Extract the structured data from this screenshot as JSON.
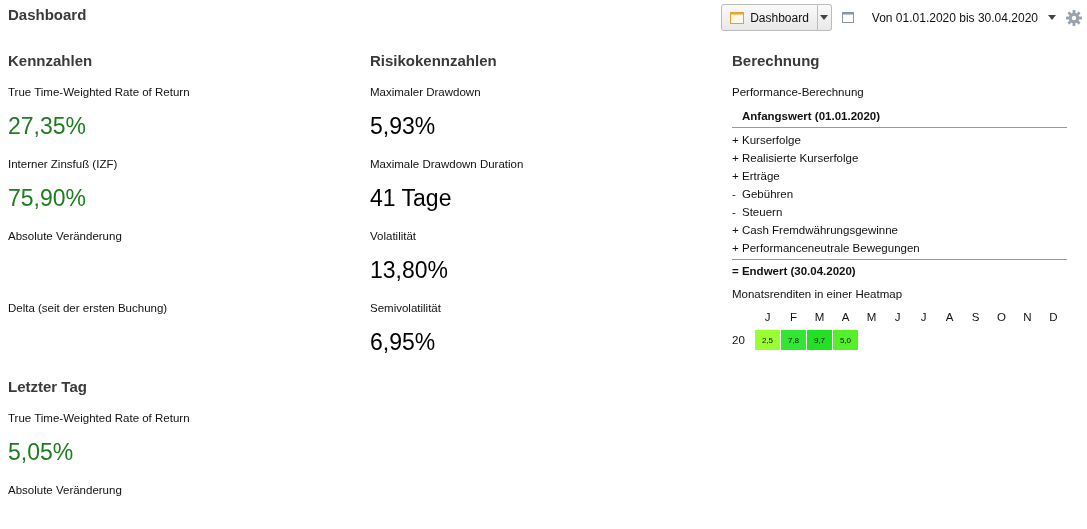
{
  "title": "Dashboard",
  "toolbar": {
    "view_button": "Dashboard",
    "date_range": "Von 01.01.2020 bis 30.04.2020"
  },
  "columns": [
    {
      "heading": "Kennzahlen",
      "metrics": [
        {
          "label": "True Time-Weighted Rate of Return",
          "value": "27,35%",
          "color": "#1e7d1e"
        },
        {
          "label": "Interner Zinsfuß (IZF)",
          "value": "75,90%",
          "color": "#1e7d1e"
        },
        {
          "label": "Absolute Veränderung"
        },
        {
          "label": "Delta (seit der ersten Buchung)"
        }
      ]
    },
    {
      "heading": "Risikokennzahlen",
      "metrics": [
        {
          "label": "Maximaler Drawdown",
          "value": "5,93%",
          "color": "#000000"
        },
        {
          "label": "Maximale Drawdown Duration",
          "value": "41 Tage",
          "color": "#000000"
        },
        {
          "label": "Volatilität",
          "value": "13,80%",
          "color": "#000000"
        },
        {
          "label": "Semivolatilität",
          "value": "6,95%",
          "color": "#000000"
        }
      ]
    }
  ],
  "last_day": {
    "heading": "Letzter Tag",
    "metrics": [
      {
        "label": "True Time-Weighted Rate of Return",
        "value": "5,05%",
        "color": "#1e7d1e"
      },
      {
        "label": "Absolute Veränderung"
      }
    ]
  },
  "calculation": {
    "heading": "Berechnung",
    "subtitle": "Performance-Berechnung",
    "lines": [
      {
        "kind": "start",
        "text": "Anfangswert (01.01.2020)"
      },
      {
        "kind": "item",
        "sign": "+",
        "text": "Kurserfolge"
      },
      {
        "kind": "item",
        "sign": "+",
        "text": "Realisierte Kurserfolge"
      },
      {
        "kind": "item",
        "sign": "+",
        "text": "Erträge"
      },
      {
        "kind": "item",
        "sign": "-",
        "text": "Gebühren"
      },
      {
        "kind": "item",
        "sign": "-",
        "text": "Steuern"
      },
      {
        "kind": "item",
        "sign": "+",
        "text": "Cash Fremdwährungsgewinne"
      },
      {
        "kind": "item",
        "sign": "+",
        "text": "Performanceneutrale Bewegungen"
      },
      {
        "kind": "end",
        "sign": "=",
        "text": "Endwert (30.04.2020)"
      }
    ]
  },
  "heatmap": {
    "title": "Monatsrenditen in einer Heatmap",
    "months": [
      "J",
      "F",
      "M",
      "A",
      "M",
      "J",
      "J",
      "A",
      "S",
      "O",
      "N",
      "D"
    ],
    "rows": [
      {
        "year": "20",
        "cells": [
          {
            "value": "2,5",
            "color": "#99ff33"
          },
          {
            "value": "7,8",
            "color": "#33e633"
          },
          {
            "value": "9,7",
            "color": "#22e022"
          },
          {
            "value": "5,0",
            "color": "#55f02a"
          }
        ]
      }
    ]
  }
}
